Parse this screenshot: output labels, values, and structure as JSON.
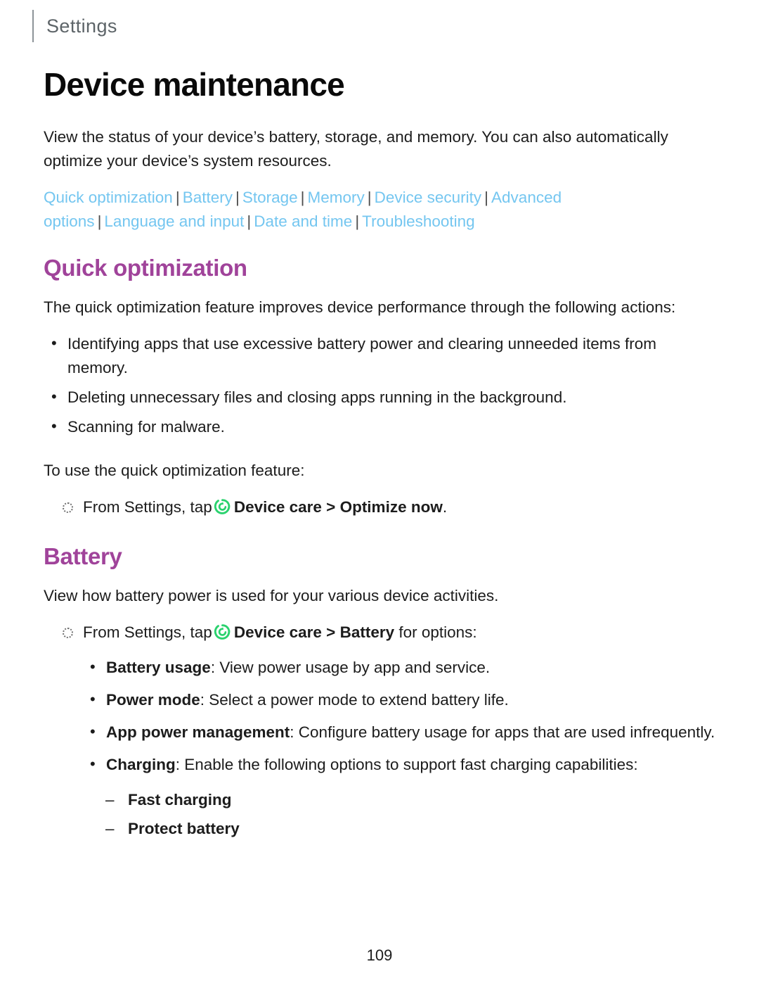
{
  "header": {
    "running_title": "Settings"
  },
  "page_title": "Device maintenance",
  "intro": "View the status of your device’s battery, storage, and memory. You can also automatically optimize your device’s system resources.",
  "xref_links": [
    "Quick optimization",
    "Battery",
    "Storage",
    "Memory",
    "Device security",
    "Advanced options",
    "Language and input",
    "Date and time",
    "Troubleshooting"
  ],
  "xref_separator": "|",
  "sections": [
    {
      "heading": "Quick optimization",
      "intro": "The quick optimization feature improves device performance through the following actions:",
      "bullets": [
        "Identifying apps that use excessive battery power and clearing unneeded items from memory.",
        "Deleting unnecessary files and closing apps running in the background.",
        "Scanning for malware."
      ],
      "lead_in": "To use the quick optimization feature:",
      "step": {
        "prefix": "From Settings, tap",
        "icon": "device-care-icon",
        "path": "Device care > Optimize now",
        "suffix": "."
      }
    },
    {
      "heading": "Battery",
      "intro": "View how battery power is used for your various device activities.",
      "step": {
        "prefix": "From Settings, tap",
        "icon": "device-care-icon",
        "path": "Device care > Battery",
        "suffix": " for options:"
      },
      "options": [
        {
          "term": "Battery usage",
          "desc": ": View power usage by app and service."
        },
        {
          "term": "Power mode",
          "desc": ": Select a power mode to extend battery life."
        },
        {
          "term": "App power management",
          "desc": ": Configure battery usage for apps that are used infrequently."
        },
        {
          "term": "Charging",
          "desc": ": Enable the following options to support fast charging capabilities:"
        }
      ],
      "charging_sub_options": [
        "Fast charging",
        "Protect battery"
      ]
    }
  ],
  "footer": {
    "page_number": "109"
  },
  "colors": {
    "link": "#74c6f0",
    "section_heading": "#a0439a",
    "device_care_green": "#2ad26e",
    "body_text": "#1c1c1c",
    "running_header": "#5d6468"
  }
}
